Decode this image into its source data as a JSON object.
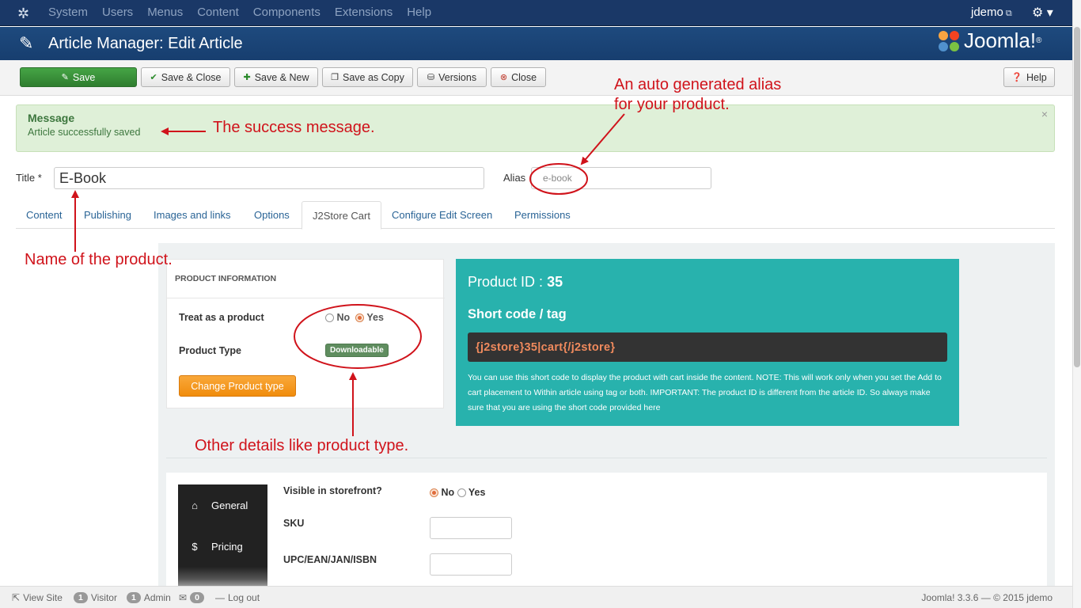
{
  "topnav": {
    "menu": [
      "System",
      "Users",
      "Menus",
      "Content",
      "Components",
      "Extensions",
      "Help"
    ],
    "user": "jdemo",
    "icons": {
      "logo": "joomla-icon",
      "external": "external-link-icon",
      "settings": "gear-icon"
    }
  },
  "header": {
    "title": "Article Manager: Edit Article",
    "brand": "Joomla!",
    "brand_mark": "®"
  },
  "toolbar": {
    "save": "Save",
    "save_close": "Save & Close",
    "save_new": "Save & New",
    "save_copy": "Save as Copy",
    "versions": "Versions",
    "close": "Close",
    "help": "Help"
  },
  "message": {
    "heading": "Message",
    "text": "Article successfully saved",
    "close": "×"
  },
  "form": {
    "title_label": "Title *",
    "title_value": "E-Book",
    "alias_label": "Alias",
    "alias_placeholder": "e-book"
  },
  "tabs": [
    "Content",
    "Publishing",
    "Images and links",
    "Options",
    "J2Store Cart",
    "Configure Edit Screen",
    "Permissions"
  ],
  "product_info": {
    "heading": "PRODUCT INFORMATION",
    "treat_label": "Treat as a product",
    "no": "No",
    "yes": "Yes",
    "treat_selected": "Yes",
    "type_label": "Product Type",
    "type_value": "Downloadable",
    "change_button": "Change Product type"
  },
  "shortcode": {
    "pid_label": "Product ID :",
    "pid_value": "35",
    "heading": "Short code / tag",
    "code": "{j2store}35|cart{/j2store}",
    "note": "You can use this short code to display the product with cart inside the content. NOTE: This will work only when you set the Add to cart placement to Within article using tag or both. IMPORTANT: The product ID is different from the article ID. So always make sure that you are using the short code provided here"
  },
  "product_tabs": {
    "general": "General",
    "pricing": "Pricing",
    "partial": "I        t"
  },
  "fields": {
    "visible_label": "Visible in storefront?",
    "visible_no": "No",
    "visible_yes": "Yes",
    "visible_selected": "No",
    "sku_label": "SKU",
    "upc_label": "UPC/EAN/JAN/ISBN"
  },
  "annotations": {
    "success": "The success message.",
    "alias_line1": "An auto generated alias",
    "alias_line2": "for your product.",
    "name": "Name of the product.",
    "details": "Other details like product type."
  },
  "status": {
    "view_site": "View Site",
    "visitor_count": "1",
    "visitor": "Visitor",
    "admin_count": "1",
    "admin": "Admin",
    "msg_count": "0",
    "logout": "Log out",
    "version": "Joomla! 3.3.6 — © 2015 jdemo"
  },
  "colors": {
    "nav_bg": "#1a3867",
    "header_bg": "#1e4a7e",
    "save_green": "#46a546",
    "teal": "#28b2ad",
    "annotation_red": "#d0131b",
    "orange": "#f08c0c"
  }
}
